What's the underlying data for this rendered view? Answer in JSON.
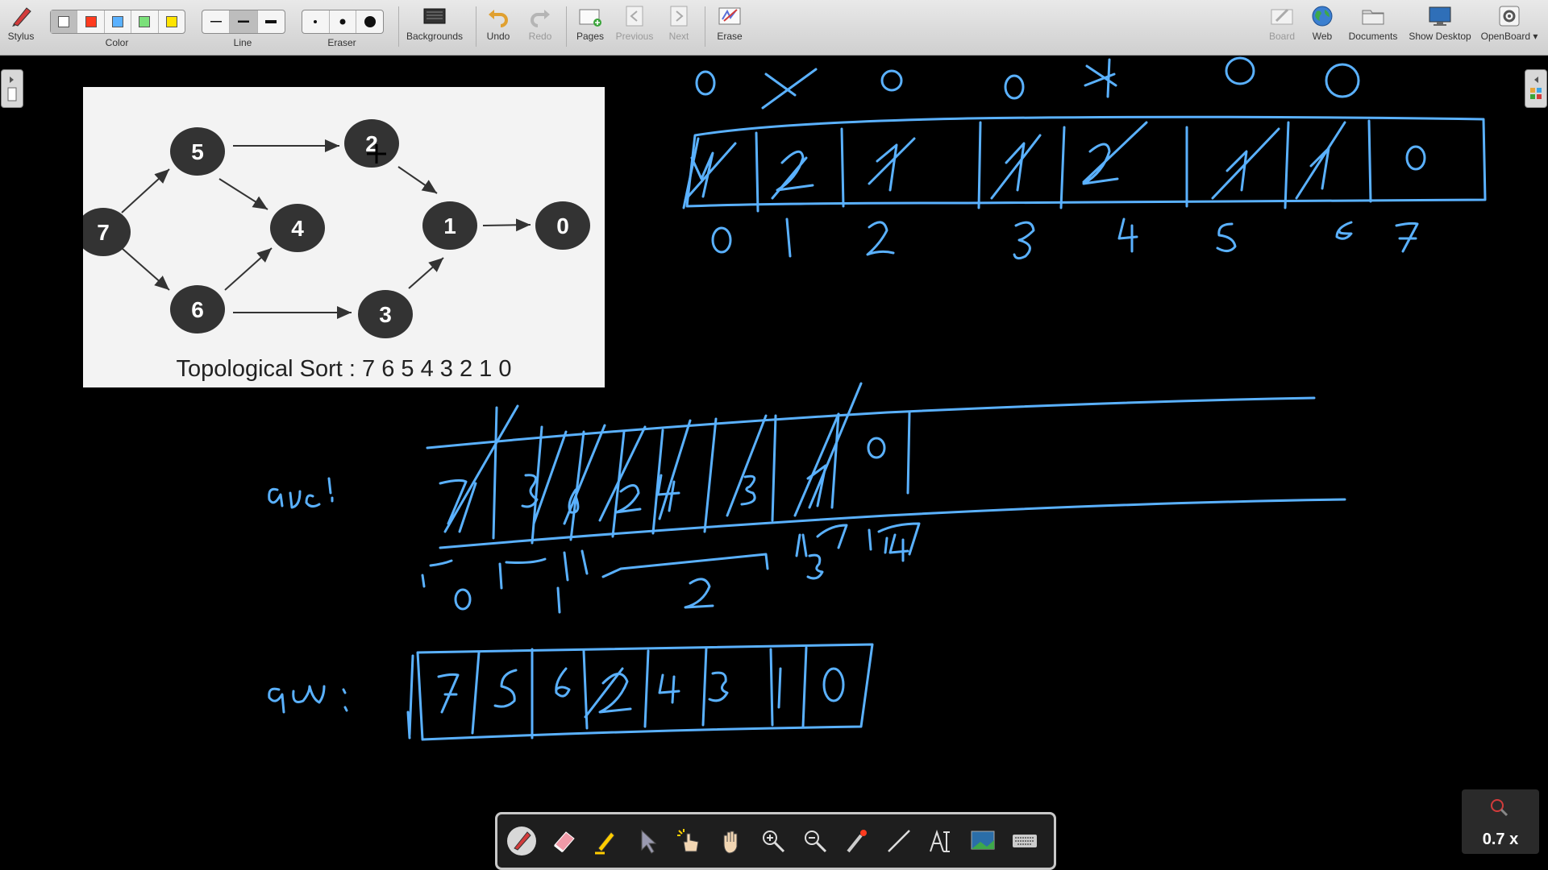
{
  "toolbar": {
    "stylus": "Stylus",
    "color": "Color",
    "colors": [
      "#ffffff",
      "#ff3b1f",
      "#5ab1ff",
      "#7be07a",
      "#ffe400"
    ],
    "line": "Line",
    "eraser": "Eraser",
    "backgrounds": "Backgrounds",
    "undo": "Undo",
    "redo": "Redo",
    "pages": "Pages",
    "previous": "Previous",
    "next": "Next",
    "erase": "Erase",
    "board": "Board",
    "web": "Web",
    "documents": "Documents",
    "show_desktop": "Show Desktop",
    "openboard": "OpenBoard"
  },
  "graph": {
    "nodes": [
      "5",
      "2",
      "7",
      "4",
      "1",
      "0",
      "6",
      "3"
    ],
    "caption": "Topological Sort : 7 6 5 4 3 2 1 0"
  },
  "ink_color": "#5ab1ff",
  "zoom": "0.7 x"
}
